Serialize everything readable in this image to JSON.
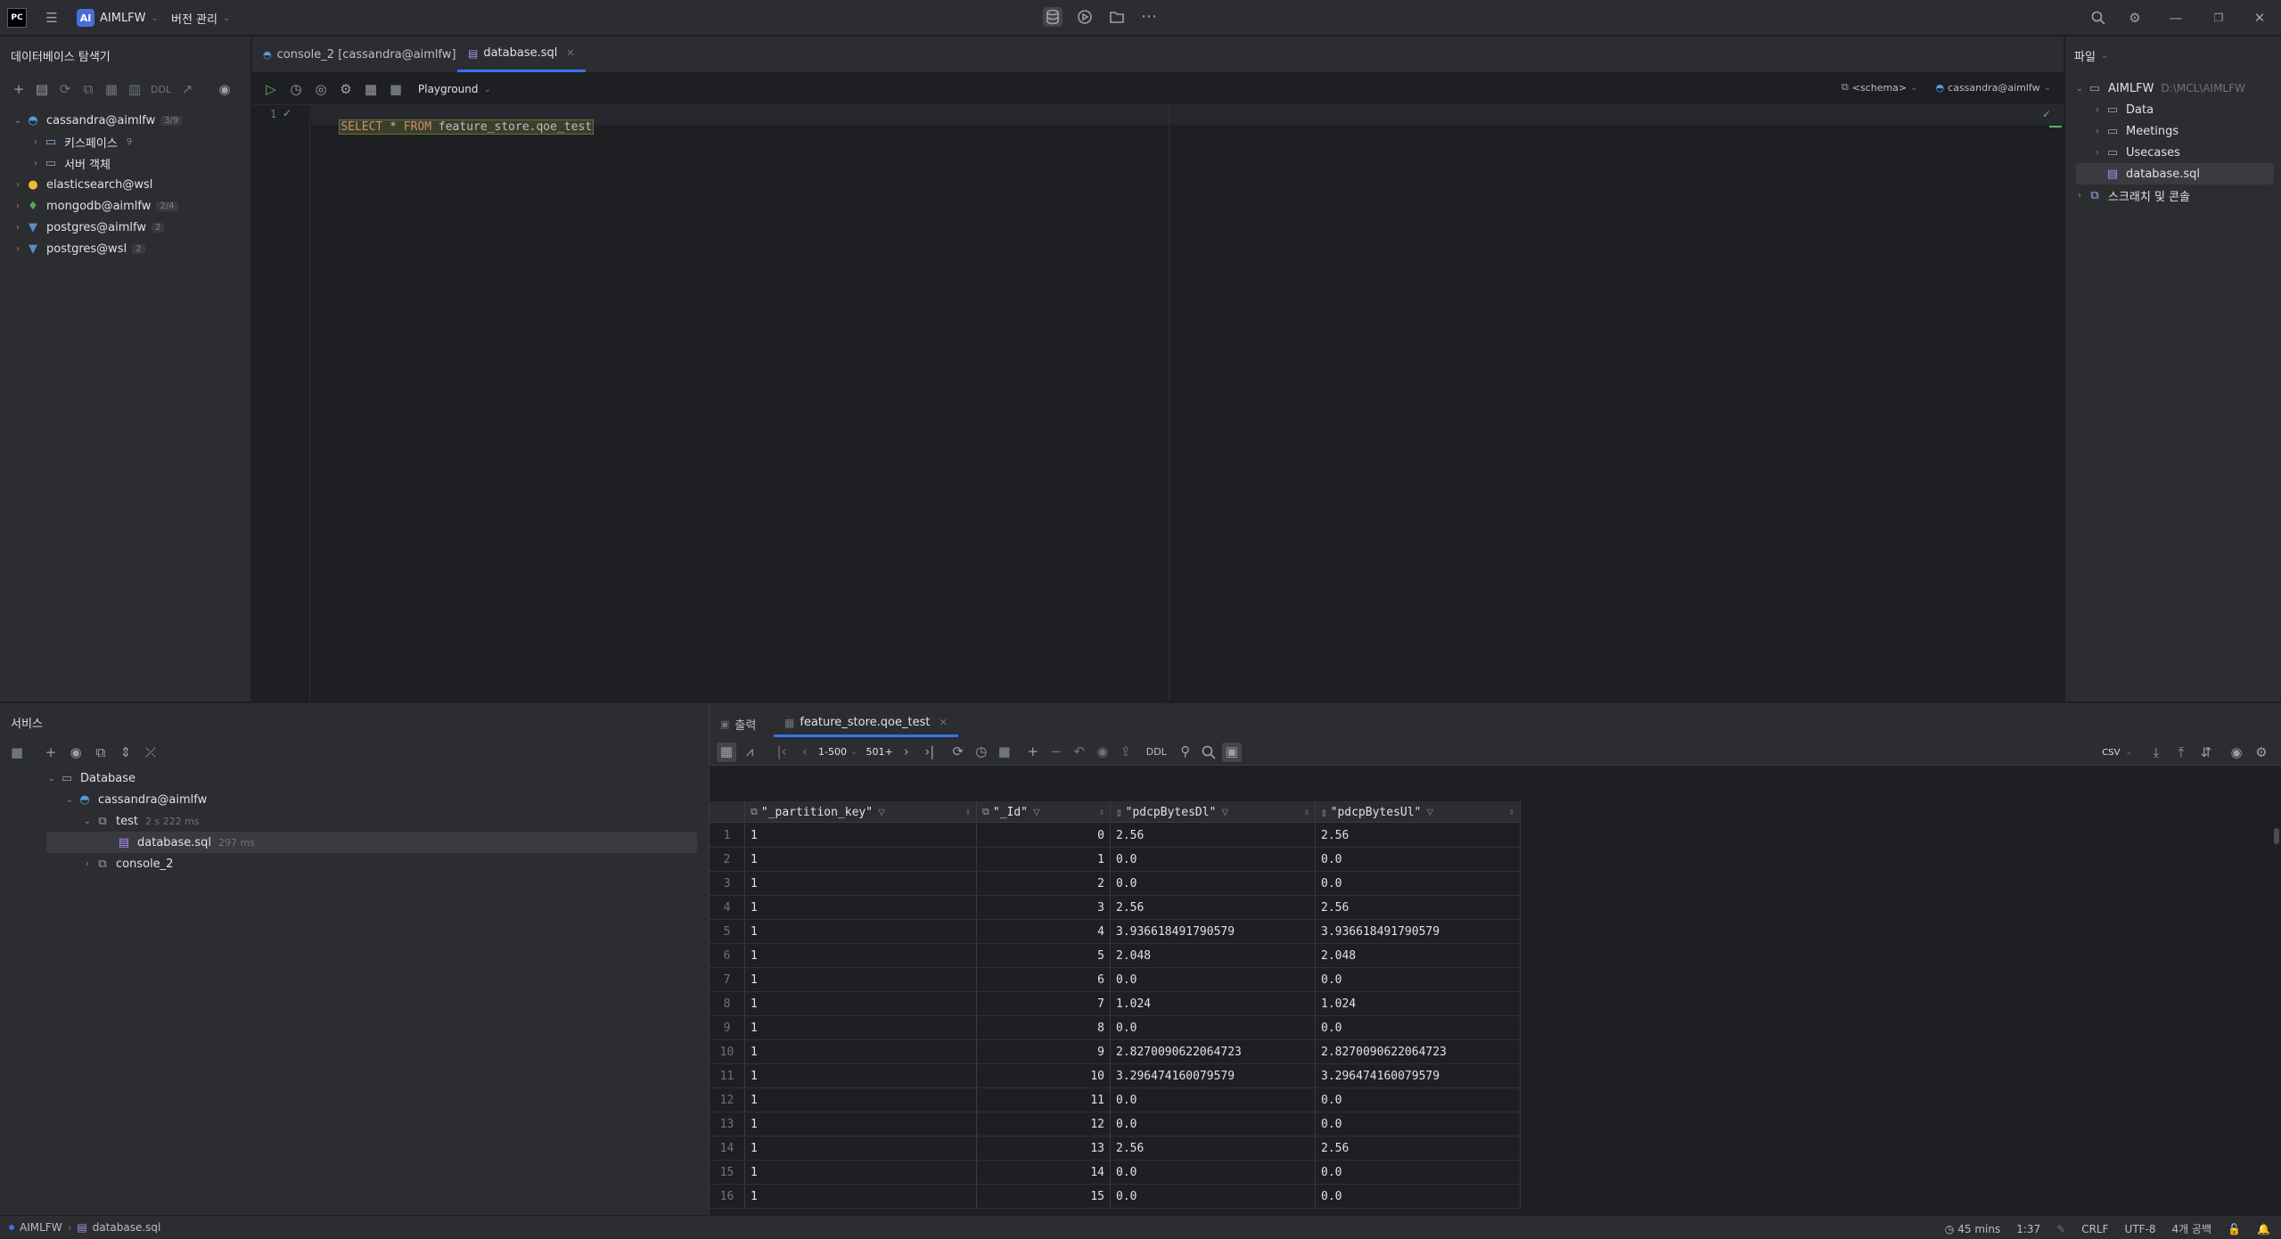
{
  "titlebar": {
    "project_badge": "AI",
    "project_name": "AIMLFW",
    "vcs_label": "버전 관리"
  },
  "db_explorer": {
    "title": "데이터베이스 탐색기",
    "toolbar_ddl": "DDL",
    "tree": [
      {
        "label": "cassandra@aimlfw",
        "badge": "3/9"
      },
      {
        "label": "키스페이스",
        "badge": "9"
      },
      {
        "label": "서버 객체",
        "badge": ""
      },
      {
        "label": "elasticsearch@wsl",
        "badge": ""
      },
      {
        "label": "mongodb@aimlfw",
        "badge": "2/4"
      },
      {
        "label": "postgres@aimlfw",
        "badge": "2"
      },
      {
        "label": "postgres@wsl",
        "badge": "2"
      }
    ]
  },
  "editor": {
    "tabs": [
      {
        "label": "console_2 [cassandra@aimlfw]"
      },
      {
        "label": "database.sql"
      }
    ],
    "playground_label": "Playground",
    "schema_label": "<schema>",
    "datasource_label": "cassandra@aimlfw",
    "line_number": "1",
    "code": {
      "kw1": "SELECT",
      "star": " * ",
      "kw2": "FROM",
      "rest": " feature_store.qoe_test"
    }
  },
  "files_panel": {
    "title": "파일",
    "root": "AIMLFW",
    "root_path": "D:\\MCL\\AIMLFW",
    "items": [
      "Data",
      "Meetings",
      "Usecases",
      "database.sql",
      "스크래치 및 콘솔"
    ]
  },
  "services": {
    "title": "서비스",
    "tree": [
      {
        "label": "Database",
        "meta": ""
      },
      {
        "label": "cassandra@aimlfw",
        "meta": ""
      },
      {
        "label": "test",
        "meta": "2 s 222 ms"
      },
      {
        "label": "database.sql",
        "meta": "297 ms"
      },
      {
        "label": "console_2",
        "meta": ""
      }
    ],
    "result_tabs": [
      {
        "label": "출력"
      },
      {
        "label": "feature_store.qoe_test"
      }
    ],
    "paging": "1-500",
    "count": "501+",
    "ddl": "DDL",
    "export_format": "CSV",
    "columns": [
      "\"_partition_key\"",
      "\"_Id\"",
      "\"pdcpBytesDl\"",
      "\"pdcpBytesUl\""
    ],
    "rows": [
      [
        "1",
        "1",
        "0",
        "2.56",
        "2.56"
      ],
      [
        "2",
        "1",
        "1",
        "0.0",
        "0.0"
      ],
      [
        "3",
        "1",
        "2",
        "0.0",
        "0.0"
      ],
      [
        "4",
        "1",
        "3",
        "2.56",
        "2.56"
      ],
      [
        "5",
        "1",
        "4",
        "3.936618491790579",
        "3.936618491790579"
      ],
      [
        "6",
        "1",
        "5",
        "2.048",
        "2.048"
      ],
      [
        "7",
        "1",
        "6",
        "0.0",
        "0.0"
      ],
      [
        "8",
        "1",
        "7",
        "1.024",
        "1.024"
      ],
      [
        "9",
        "1",
        "8",
        "0.0",
        "0.0"
      ],
      [
        "10",
        "1",
        "9",
        "2.8270090622064723",
        "2.8270090622064723"
      ],
      [
        "11",
        "1",
        "10",
        "3.296474160079579",
        "3.296474160079579"
      ],
      [
        "12",
        "1",
        "11",
        "0.0",
        "0.0"
      ],
      [
        "13",
        "1",
        "12",
        "0.0",
        "0.0"
      ],
      [
        "14",
        "1",
        "13",
        "2.56",
        "2.56"
      ],
      [
        "15",
        "1",
        "14",
        "0.0",
        "0.0"
      ],
      [
        "16",
        "1",
        "15",
        "0.0",
        "0.0"
      ]
    ]
  },
  "statusbar": {
    "project": "AIMLFW",
    "file": "database.sql",
    "time": "45 mins",
    "position": "1:37",
    "line_sep": "CRLF",
    "encoding": "UTF-8",
    "indent": "4개 공백"
  }
}
